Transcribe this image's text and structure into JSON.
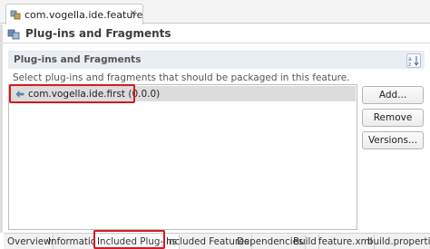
{
  "editor": {
    "tab_title": "com.vogella.ide.feature",
    "close_glyph": "✕"
  },
  "form": {
    "title": "Plug-ins and Fragments"
  },
  "section": {
    "title": "Plug-ins and Fragments",
    "description": "Select plug-ins and fragments that should be packaged in this feature.",
    "sort_icon": "a-z sort icon"
  },
  "plugins": [
    {
      "label": "com.vogella.ide.first (0.0.0)"
    }
  ],
  "buttons": {
    "add": "Add...",
    "remove": "Remove",
    "versions": "Versions..."
  },
  "page_tabs": [
    {
      "label": "Overview"
    },
    {
      "label": "Information"
    },
    {
      "label": "Included Plug-ins",
      "active": true
    },
    {
      "label": "Included Features"
    },
    {
      "label": "Dependencies"
    },
    {
      "label": "Build"
    },
    {
      "label": "feature.xml"
    },
    {
      "label": "build.properties"
    }
  ],
  "colors": {
    "annotation_red": "#d01b22",
    "section_bar": "#e9eef3"
  }
}
